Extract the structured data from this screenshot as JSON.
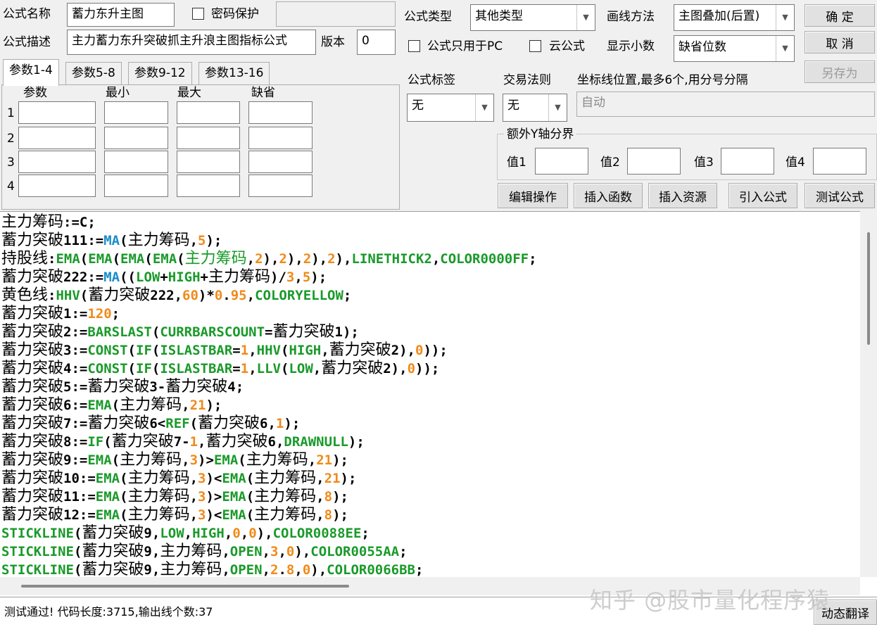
{
  "formula": {
    "name_label": "公式名称",
    "name_value": "蓄力东升主图",
    "password_label": "密码保护",
    "desc_label": "公式描述",
    "desc_value": "主力蓄力东升突破抓主升浪主图指标公式",
    "version_label": "版本",
    "version_value": "0",
    "type_label": "公式类型",
    "type_value": "其他类型",
    "draw_label": "画线方法",
    "draw_value": "主图叠加(后置)",
    "pc_only_label": "公式只用于PC",
    "cloud_label": "云公式",
    "decimal_label": "显示小数",
    "decimal_value": "缺省位数",
    "tag_label": "公式标签",
    "tag_value": "无",
    "rule_label": "交易法则",
    "rule_value": "无",
    "coord_label": "坐标线位置,最多6个,用分号分隔",
    "coord_placeholder": "自动"
  },
  "buttons": {
    "ok": "确  定",
    "cancel": "取  消",
    "save_as": "另存为",
    "edit_ops": "编辑操作",
    "insert_func": "插入函数",
    "insert_res": "插入资源",
    "import_formula": "引入公式",
    "test_formula": "测试公式",
    "dynamic_translate": "动态翻译"
  },
  "tabs": [
    "参数1-4",
    "参数5-8",
    "参数9-12",
    "参数13-16"
  ],
  "param_headers": [
    "参数",
    "最小",
    "最大",
    "缺省"
  ],
  "param_rows": [
    "1",
    "2",
    "3",
    "4"
  ],
  "yaxis": {
    "group_label": "额外Y轴分界",
    "v1": "值1",
    "v2": "值2",
    "v3": "值3",
    "v4": "值4"
  },
  "status_text": "测试通过! 代码长度:3715,输出线个数:37",
  "watermark": "知乎 @股市量化程序猿"
}
